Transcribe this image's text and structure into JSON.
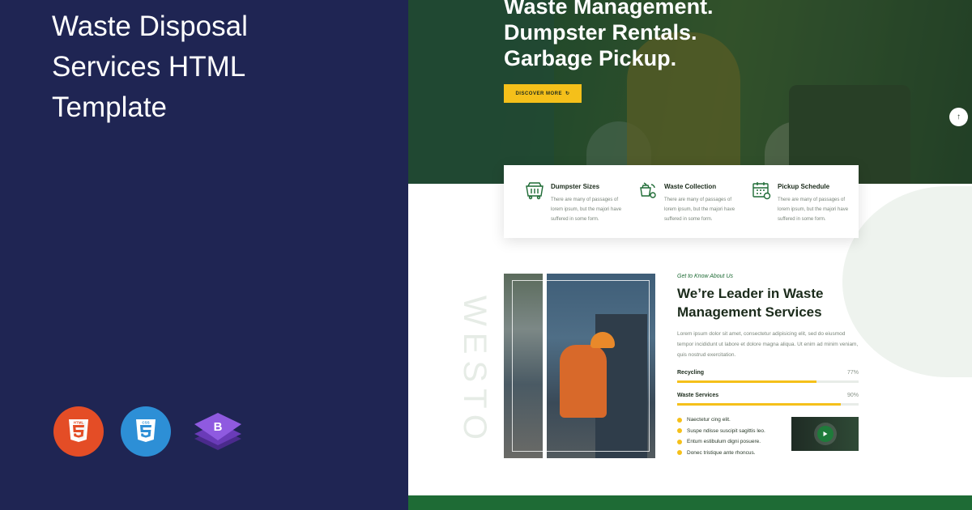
{
  "promo": {
    "title_line1": "Waste Disposal",
    "title_line2": "Services HTML",
    "title_line3": "Template",
    "badges": [
      {
        "name": "html5-icon",
        "color": "#e44d26"
      },
      {
        "name": "css3-icon",
        "color": "#2d8fd6"
      },
      {
        "name": "bootstrap-icon",
        "color": "#7b4fc9"
      }
    ]
  },
  "hero": {
    "line1": "Waste Management.",
    "line2": "Dumpster Rentals.",
    "line3": "Garbage Pickup.",
    "button_label": "DISCOVER MORE",
    "scroll_icon": "arrow-up-icon"
  },
  "features": [
    {
      "icon": "dumpster-icon",
      "title": "Dumpster Sizes",
      "text": "There are many of passages of lorem ipsum, but the majori have suffered in some form."
    },
    {
      "icon": "waste-collection-icon",
      "title": "Waste Collection",
      "text": "There are many of passages of lorem ipsum, but the majori have suffered in some form."
    },
    {
      "icon": "calendar-icon",
      "title": "Pickup Schedule",
      "text": "There are many of passages of lorem ipsum, but the majori have suffered in some form."
    }
  ],
  "about": {
    "vertical_text": "WESTO",
    "tagline": "Get to Know About Us",
    "title_line1": "We’re Leader in Waste",
    "title_line2": "Management Services",
    "text": "Lorem ipsum dolor sit amet, consectetur adipisicing elit, sed do eiusmod tempor incididunt ut labore et dolore magna aliqua. Ut enim ad minim veniam, quis nostrud exercitation.",
    "skills": [
      {
        "label": "Recycling",
        "pct_text": "77%",
        "value": 77
      },
      {
        "label": "Waste Services",
        "pct_text": "90%",
        "value": 90
      }
    ],
    "bullets": [
      "Naectetur cing elit.",
      "Suspe ndisse suscipit sagittis leo.",
      "Entum estibulum digni posuere.",
      "Donec tristique ante rhoncus."
    ]
  },
  "colors": {
    "navy": "#1f2553",
    "green": "#1e6b35",
    "yellow": "#f5c01a"
  }
}
